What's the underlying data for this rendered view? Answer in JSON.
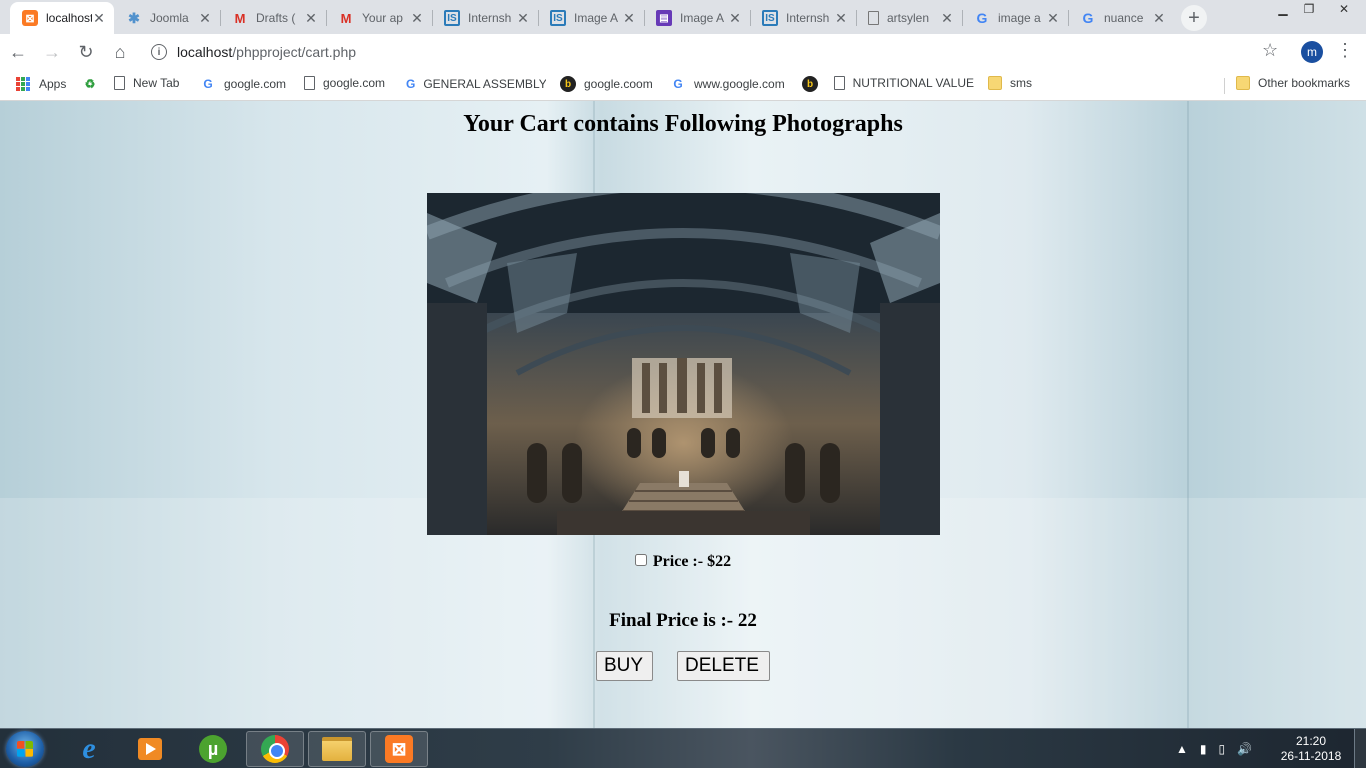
{
  "browser": {
    "tabs": [
      {
        "title": "localhost/phpproject/cart.php",
        "icon": "xampp-icon",
        "active": true
      },
      {
        "title": "Joomla",
        "icon": "joomla-icon"
      },
      {
        "title": "Drafts (",
        "icon": "gmail-icon"
      },
      {
        "title": "Your ap",
        "icon": "gmail-icon"
      },
      {
        "title": "Internsh",
        "icon": "internshala-icon"
      },
      {
        "title": "Image A",
        "icon": "internshala-icon"
      },
      {
        "title": "Image A",
        "icon": "image-icon"
      },
      {
        "title": "Internsh",
        "icon": "internshala-icon"
      },
      {
        "title": "artsylen",
        "icon": "page-icon"
      },
      {
        "title": "image a",
        "icon": "google-icon"
      },
      {
        "title": "nuance",
        "icon": "google-icon"
      }
    ],
    "address": {
      "host": "localhost",
      "path": "/phpproject/cart.php"
    },
    "profile_initial": "m",
    "bookmarks": [
      {
        "label": "Apps",
        "icon": "apps-grid-icon"
      },
      {
        "label": "",
        "icon": "recycle-icon"
      },
      {
        "label": "New Tab",
        "icon": "page-icon"
      },
      {
        "label": "google.com",
        "icon": "google-icon"
      },
      {
        "label": "google.com",
        "icon": "page-icon"
      },
      {
        "label": "GENERAL ASSEMBLY",
        "icon": "google-icon"
      },
      {
        "label": "google.coom",
        "icon": "bing-icon"
      },
      {
        "label": "www.google.com",
        "icon": "google-icon"
      },
      {
        "label": "",
        "icon": "bing-icon"
      },
      {
        "label": "NUTRITIONAL VALUE",
        "icon": "page-icon"
      },
      {
        "label": "sms",
        "icon": "folder-icon"
      }
    ],
    "other_bookmarks": "Other bookmarks"
  },
  "page": {
    "title": "Your Cart contains Following Photographs",
    "photo_alt": "photo-museum-hall",
    "price_label": "Price :- $22",
    "price_checked": false,
    "final_price": "Final Price is :- 22",
    "buy_label": "BUY",
    "delete_label": "DELETE"
  },
  "taskbar": {
    "apps": [
      "internet-explorer-icon",
      "media-player-icon",
      "utorrent-icon",
      "chrome-icon",
      "file-explorer-icon",
      "xampp-icon"
    ],
    "time": "21:20",
    "date": "26-11-2018"
  },
  "colors": {
    "active_tab": "#ffffff",
    "tab_strip": "#dee1e6",
    "profile": "#1a4fa0",
    "xampp": "#fb7a24"
  }
}
